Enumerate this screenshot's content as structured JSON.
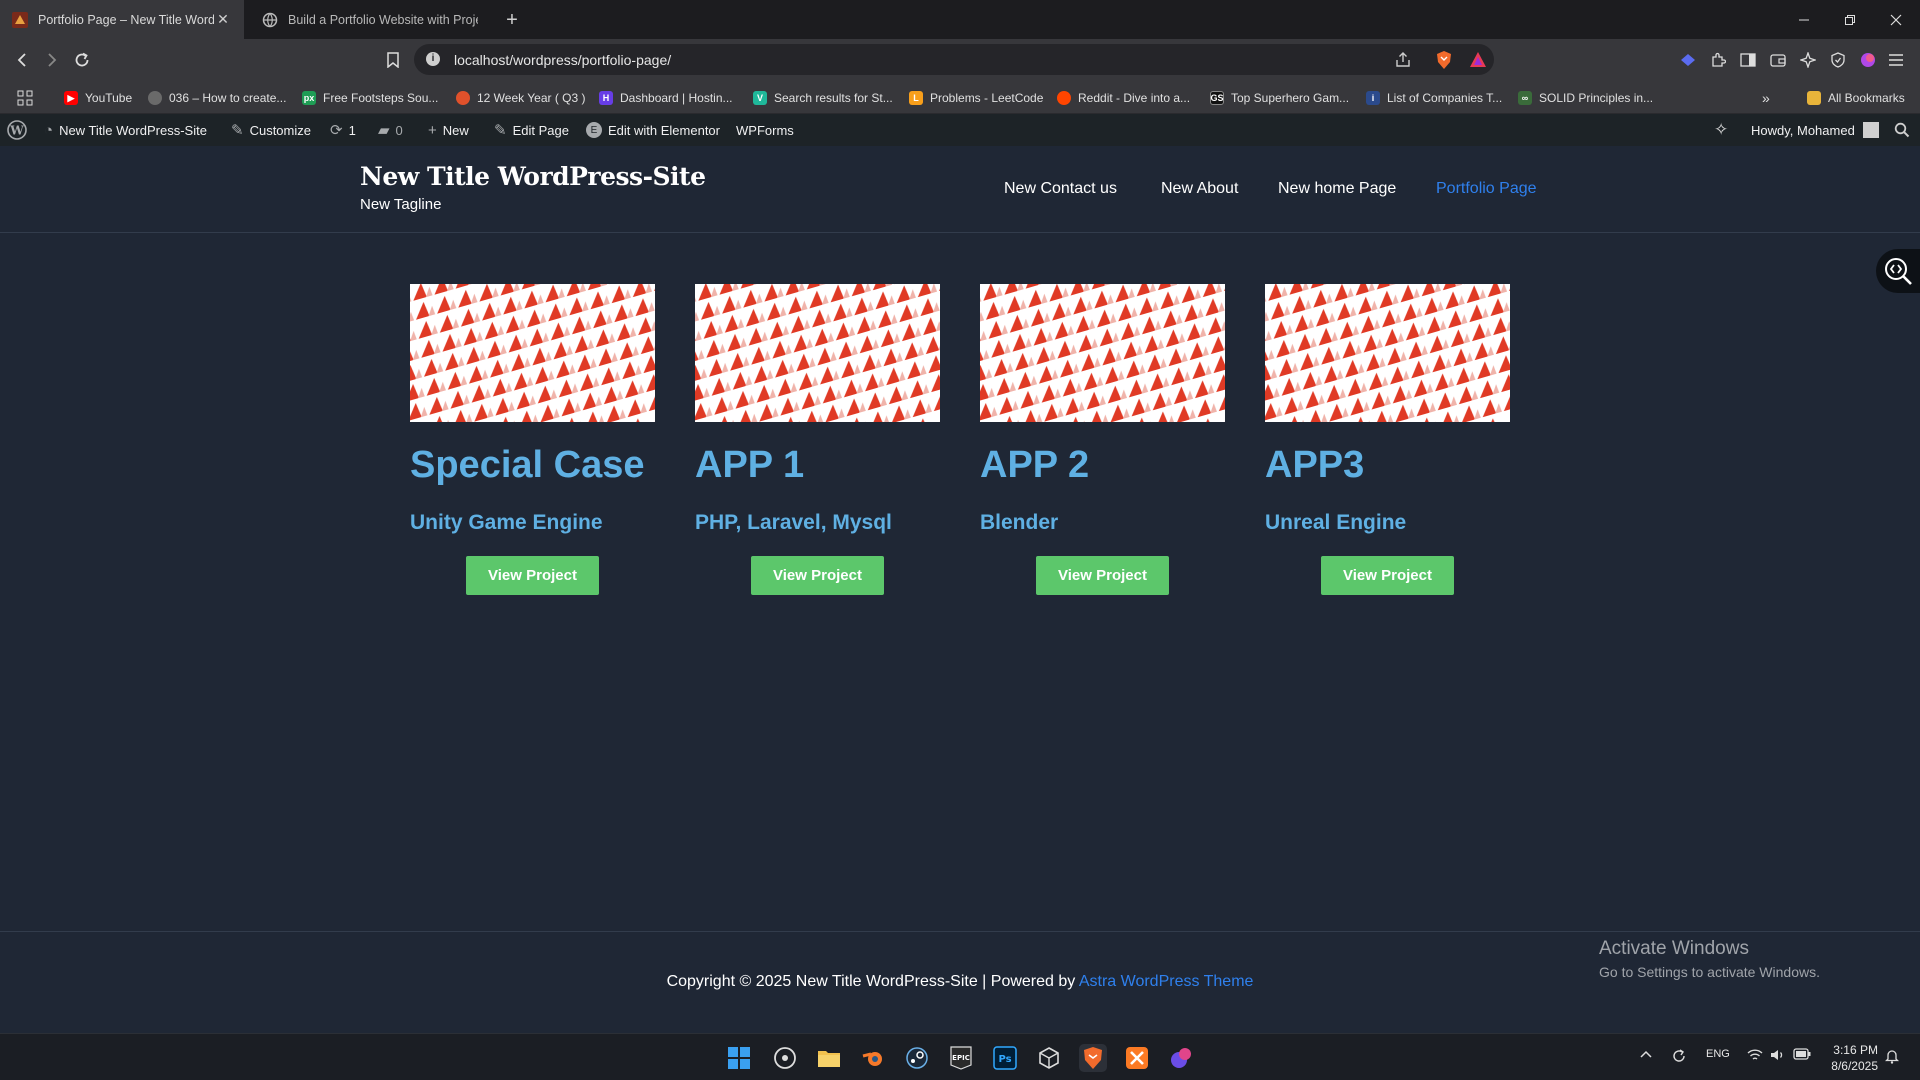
{
  "browser": {
    "tabs": [
      {
        "title": "Portfolio Page – New Title WordPress-Site",
        "active": true
      },
      {
        "title": "Build a Portfolio Website with Project",
        "active": false
      }
    ],
    "url": "localhost/wordpress/portfolio-page/",
    "bookmarks": [
      {
        "label": "YouTube",
        "icon": "youtube-icon"
      },
      {
        "label": "036 – How to create...",
        "icon": "globe-icon"
      },
      {
        "label": "Free Footsteps Sou...",
        "icon": "pixabay-icon"
      },
      {
        "label": "12 Week Year ( Q3 )",
        "icon": "fire-icon"
      },
      {
        "label": "Dashboard | Hostin...",
        "icon": "hostinger-icon"
      },
      {
        "label": "Search results for St...",
        "icon": "vector-icon"
      },
      {
        "label": "Problems - LeetCode",
        "icon": "leetcode-icon"
      },
      {
        "label": "Reddit - Dive into a...",
        "icon": "reddit-icon"
      },
      {
        "label": "Top Superhero Gam...",
        "icon": "gs-icon"
      },
      {
        "label": "List of Companies T...",
        "icon": "person-icon"
      },
      {
        "label": "SOLID Principles in...",
        "icon": "link-icon"
      }
    ],
    "all_bookmarks": "All Bookmarks"
  },
  "adminbar": {
    "site": "New Title WordPress-Site",
    "customize": "Customize",
    "updates": "1",
    "comments": "0",
    "new": "New",
    "edit_page": "Edit Page",
    "elementor": "Edit with Elementor",
    "wpforms": "WPForms",
    "howdy": "Howdy, Mohamed"
  },
  "site": {
    "title": "New Title WordPress-Site",
    "tagline": "New Tagline",
    "menu": [
      "New Contact us",
      "New About",
      "New home Page",
      "Portfolio Page"
    ],
    "current_menu": "Portfolio Page"
  },
  "portfolio": [
    {
      "title": "Special Case",
      "subtitle": "Unity Game Engine",
      "button": "View Project"
    },
    {
      "title": "APP 1",
      "subtitle": "PHP, Laravel, Mysql",
      "button": "View Project"
    },
    {
      "title": "APP 2",
      "subtitle": "Blender",
      "button": "View Project"
    },
    {
      "title": "APP3",
      "subtitle": "Unreal Engine",
      "button": "View Project"
    }
  ],
  "footer": {
    "copyright": "Copyright © 2025 New Title WordPress-Site | Powered by ",
    "theme_link": "Astra WordPress Theme"
  },
  "watermark": {
    "line1": "Activate Windows",
    "line2": "Go to Settings to activate Windows."
  },
  "taskbar": {
    "lang": "ENG",
    "time": "3:16 PM",
    "date": "8/6/2025"
  },
  "colors": {
    "page_bg": "#1f2735",
    "accent": "#2f80ed",
    "portfolio_text": "#5fb0e3",
    "button": "#5cc76b"
  }
}
